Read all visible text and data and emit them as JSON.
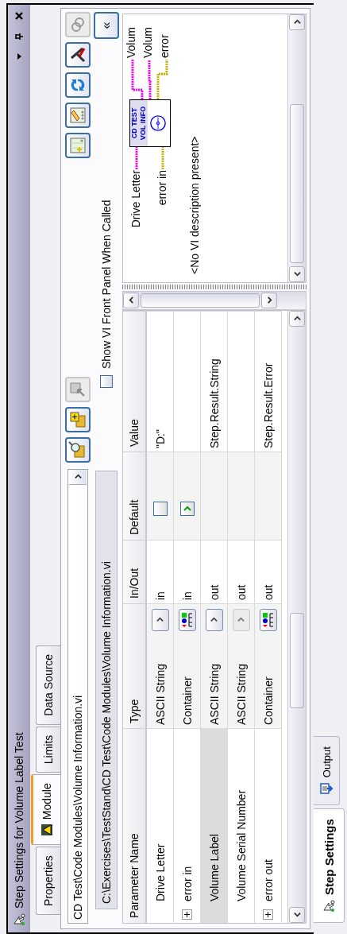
{
  "window": {
    "title": "Step Settings for Volume Label Test"
  },
  "tabs": [
    {
      "label": "Properties",
      "selected": false,
      "icon": false
    },
    {
      "label": "Module",
      "selected": true,
      "icon": true
    },
    {
      "label": "Limits",
      "selected": false,
      "icon": false
    },
    {
      "label": "Data Source",
      "selected": false,
      "icon": false
    }
  ],
  "module": {
    "vi_path": "CD Test\\Code Modules\\Volume Information.vi",
    "resolved_path": "C:\\Exercises\\TestStand\\CD Test\\Code Modules\\Volume Information.vi",
    "show_front_panel": {
      "label": "Show VI Front Panel When Called",
      "checked": false
    },
    "collapse_button": "«",
    "toolbar_left": [
      {
        "kind": "search-folder",
        "disabled": false
      },
      {
        "kind": "folder-add",
        "disabled": false
      },
      {
        "kind": "import",
        "disabled": true
      }
    ],
    "toolbar_right": [
      {
        "kind": "new-panel",
        "disabled": false
      },
      {
        "kind": "edit-panel",
        "disabled": false
      },
      {
        "kind": "refresh",
        "disabled": false
      },
      {
        "kind": "tools",
        "disabled": false
      },
      {
        "kind": "link",
        "disabled": true
      }
    ]
  },
  "table": {
    "columns": [
      "Parameter Name",
      "Type",
      "In/Out",
      "Default",
      "Value"
    ],
    "rows": [
      {
        "name": "Drive Letter",
        "kind": "string",
        "expandable": false,
        "selected": false,
        "type": "ASCII String",
        "type_disabled": false,
        "direction": "in",
        "default": {
          "checked": false
        },
        "value": "\"D:\""
      },
      {
        "name": "error in",
        "kind": "cluster",
        "expandable": true,
        "selected": false,
        "type": "Container",
        "type_disabled": false,
        "direction": "in",
        "default": {
          "checked": true
        }
      },
      {
        "name": "Volume Label",
        "kind": "string",
        "expandable": false,
        "selected": true,
        "type": "ASCII String",
        "type_disabled": false,
        "direction": "out",
        "value": "Step.Result.String"
      },
      {
        "name": "Volume Serial Number",
        "kind": "string",
        "expandable": false,
        "selected": false,
        "type": "ASCII String",
        "type_disabled": true,
        "direction": "out"
      },
      {
        "name": "error out",
        "kind": "cluster",
        "expandable": true,
        "selected": false,
        "type": "Container",
        "type_disabled": false,
        "direction": "out",
        "value": "Step.Result.Error"
      }
    ]
  },
  "vi_panel": {
    "inputs": [
      {
        "label": "Drive Letter",
        "kind": "string"
      },
      {
        "label": "error in",
        "kind": "error"
      }
    ],
    "icon_text": [
      "CD TEST",
      "VOL INFO"
    ],
    "outputs": [
      {
        "label": "Volum",
        "kind": "string"
      },
      {
        "label": "Volum",
        "kind": "string"
      },
      {
        "label": "error",
        "kind": "error"
      }
    ],
    "description": "<No VI description present>"
  },
  "bottom_tabs": [
    {
      "label": "Step Settings",
      "selected": true,
      "kind": "step"
    },
    {
      "label": "Output",
      "selected": false,
      "kind": "output"
    }
  ]
}
